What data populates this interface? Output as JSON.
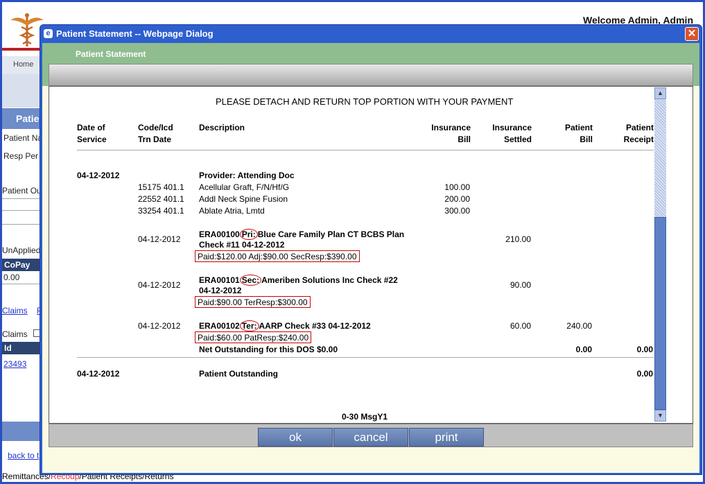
{
  "background": {
    "welcome": "Welcome Admin, Admin",
    "home_tab": "Home",
    "section_title": "Patie",
    "patient_name_label": "Patient Na",
    "resp_person_label": "Resp Per",
    "patient_out_label": "Patient Ou",
    "unapplied_label": "UnApplied",
    "copay_header": "CoPay",
    "copay_value": "0.00",
    "claims_link": "Claims",
    "claims_link2": "P",
    "claims_label": "Claims",
    "id_header": "Id",
    "id_value": "23493",
    "back_link": "back to t",
    "footer_pre": "Remittances/",
    "footer_red": "Recoup",
    "footer_post": "/Patient Receipts/Returns"
  },
  "dialog": {
    "title": "Patient Statement -- Webpage Dialog",
    "header": "Patient Statement",
    "detach_notice": "PLEASE DETACH AND RETURN TOP PORTION WITH YOUR PAYMENT",
    "columns": {
      "dos_1": "Date of",
      "dos_2": "Service",
      "code_1": "Code/Icd",
      "code_2": "Trn Date",
      "desc": "Description",
      "ins_bill_1": "Insurance",
      "ins_bill_2": "Bill",
      "ins_settled_1": "Insurance",
      "ins_settled_2": "Settled",
      "pat_bill_1": "Patient",
      "pat_bill_2": "Bill",
      "pat_receipt_1": "Patient",
      "pat_receipt_2": "Receipt"
    },
    "dos_date": "04-12-2012",
    "provider": "Provider: Attending Doc",
    "procedures": [
      {
        "code": "15175 401.1",
        "desc": "Acellular Graft, F/N/Hf/G",
        "ins_bill": "100.00"
      },
      {
        "code": "22552 401.1",
        "desc": "Addl Neck Spine Fusion",
        "ins_bill": "200.00"
      },
      {
        "code": "33254 401.1",
        "desc": "Ablate Atria, Lmtd",
        "ins_bill": "300.00"
      }
    ],
    "eras": [
      {
        "date": "04-12-2012",
        "era": "ERA00100",
        "tag": "Pri:",
        "payer": "Blue Care Family Plan CT BCBS Plan",
        "line2": "Check #11 04-12-2012",
        "summary": "Paid:$120.00 Adj:$90.00 SecResp:$390.00",
        "settled": "210.00",
        "pat_bill": ""
      },
      {
        "date": "04-12-2012",
        "era": "ERA00101",
        "tag": "Sec:",
        "payer": "Ameriben Solutions Inc Check #22",
        "line2": "04-12-2012",
        "summary": "Paid:$90.00 TerResp:$300.00",
        "settled": "90.00",
        "pat_bill": ""
      },
      {
        "date": "04-12-2012",
        "era": "ERA00102",
        "tag": "Ter:",
        "payer": "AARP Check #33 04-12-2012",
        "line2": "",
        "summary": "Paid:$60.00 PatResp:$240.00",
        "settled": "60.00",
        "pat_bill": "240.00"
      }
    ],
    "net_outstanding": "Net Outstanding for this DOS $0.00",
    "net_pat_bill": "0.00",
    "net_pat_receipt": "0.00",
    "po_date": "04-12-2012",
    "patient_outstanding": "Patient Outstanding",
    "po_value": "0.00",
    "msg_code": "0-30 MsgY1",
    "buttons": {
      "ok": "ok",
      "cancel": "cancel",
      "print": "print"
    }
  },
  "colors": {
    "title_bar": "#2e5fcf",
    "header_green": "#8fbd90",
    "button_blue": "#6a84b6",
    "highlight_red": "#cc0000"
  }
}
